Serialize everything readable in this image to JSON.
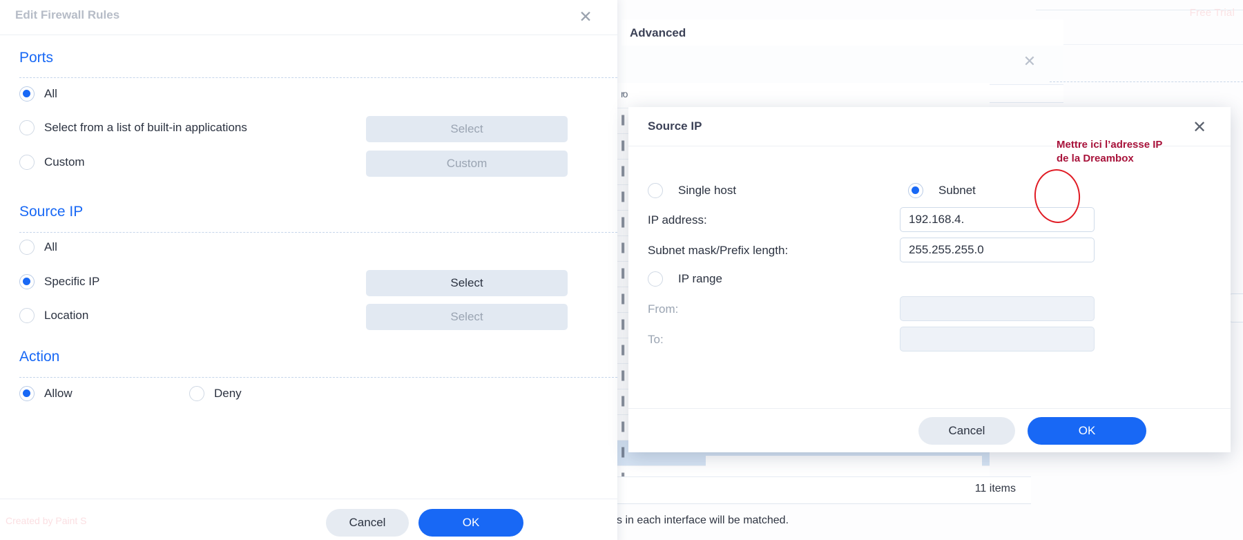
{
  "background": {
    "free_trial_label": "Free Trial",
    "advanced_panel_title": "Advanced",
    "close_icon": "close-icon",
    "row_mark": "||",
    "row_mark_head": "ro",
    "items_count": "11 items",
    "footer_note": "s in each interface will be matched.",
    "watermark_large": "Created by Paint S",
    "watermark_small": "Created by Paint S",
    "rows": [
      {
        "mark": "ro",
        "selected": false
      },
      {
        "mark": "||",
        "selected": false
      },
      {
        "mark": "||",
        "selected": false
      },
      {
        "mark": "||",
        "selected": false
      },
      {
        "mark": "||",
        "selected": false
      },
      {
        "mark": "||",
        "selected": false
      },
      {
        "mark": "||",
        "selected": false
      },
      {
        "mark": "||",
        "selected": true
      },
      {
        "mark": "||",
        "selected": false
      }
    ]
  },
  "firewall_dialog": {
    "title": "Edit Firewall Rules",
    "close_icon": "close-icon",
    "sections": [
      {
        "heading": "Ports",
        "options": [
          {
            "label": "All",
            "selected": true,
            "button": null
          },
          {
            "label": "Select from a list of built-in applications",
            "selected": false,
            "button": {
              "label": "Select",
              "enabled": false
            }
          },
          {
            "label": "Custom",
            "selected": false,
            "button": {
              "label": "Custom",
              "enabled": false
            }
          }
        ]
      },
      {
        "heading": "Source IP",
        "options": [
          {
            "label": "All",
            "selected": false,
            "button": null
          },
          {
            "label": "Specific IP",
            "selected": true,
            "button": {
              "label": "Select",
              "enabled": true
            }
          },
          {
            "label": "Location",
            "selected": false,
            "button": {
              "label": "Select",
              "enabled": false
            }
          }
        ]
      },
      {
        "heading": "Action",
        "options": [
          {
            "label": "Allow",
            "selected": true,
            "button": null
          },
          {
            "label": "Deny",
            "selected": false,
            "button": null
          }
        ]
      }
    ],
    "footer": {
      "cancel_label": "Cancel",
      "ok_label": "OK"
    },
    "watermark": "Created by Paint S"
  },
  "source_ip_modal": {
    "title": "Source IP",
    "close_icon": "close-icon",
    "mode_single_host": {
      "label": "Single host",
      "selected": false
    },
    "mode_subnet": {
      "label": "Subnet",
      "selected": true
    },
    "mode_ip_range": {
      "label": "IP range",
      "selected": false
    },
    "fields": {
      "ip_address_label": "IP address:",
      "ip_address_value": "192.168.4.",
      "subnet_mask_label": "Subnet mask/Prefix length:",
      "subnet_mask_value": "255.255.255.0",
      "from_label": "From:",
      "from_value": "",
      "to_label": "To:",
      "to_value": ""
    },
    "footer": {
      "cancel_label": "Cancel",
      "ok_label": "OK"
    }
  },
  "annotation": {
    "text": "Mettre ici l’adresse IP\nde la Dreambox",
    "color": "#a8123a",
    "circle_color": "#e01b24"
  },
  "colors": {
    "accent_blue": "#1868f5",
    "section_heading_blue": "#1868f5",
    "button_grey": "#e6ebf2",
    "disabled_text": "#9aa4b2",
    "text_dark": "#2b3240",
    "annotation_red": "#a8123a"
  }
}
